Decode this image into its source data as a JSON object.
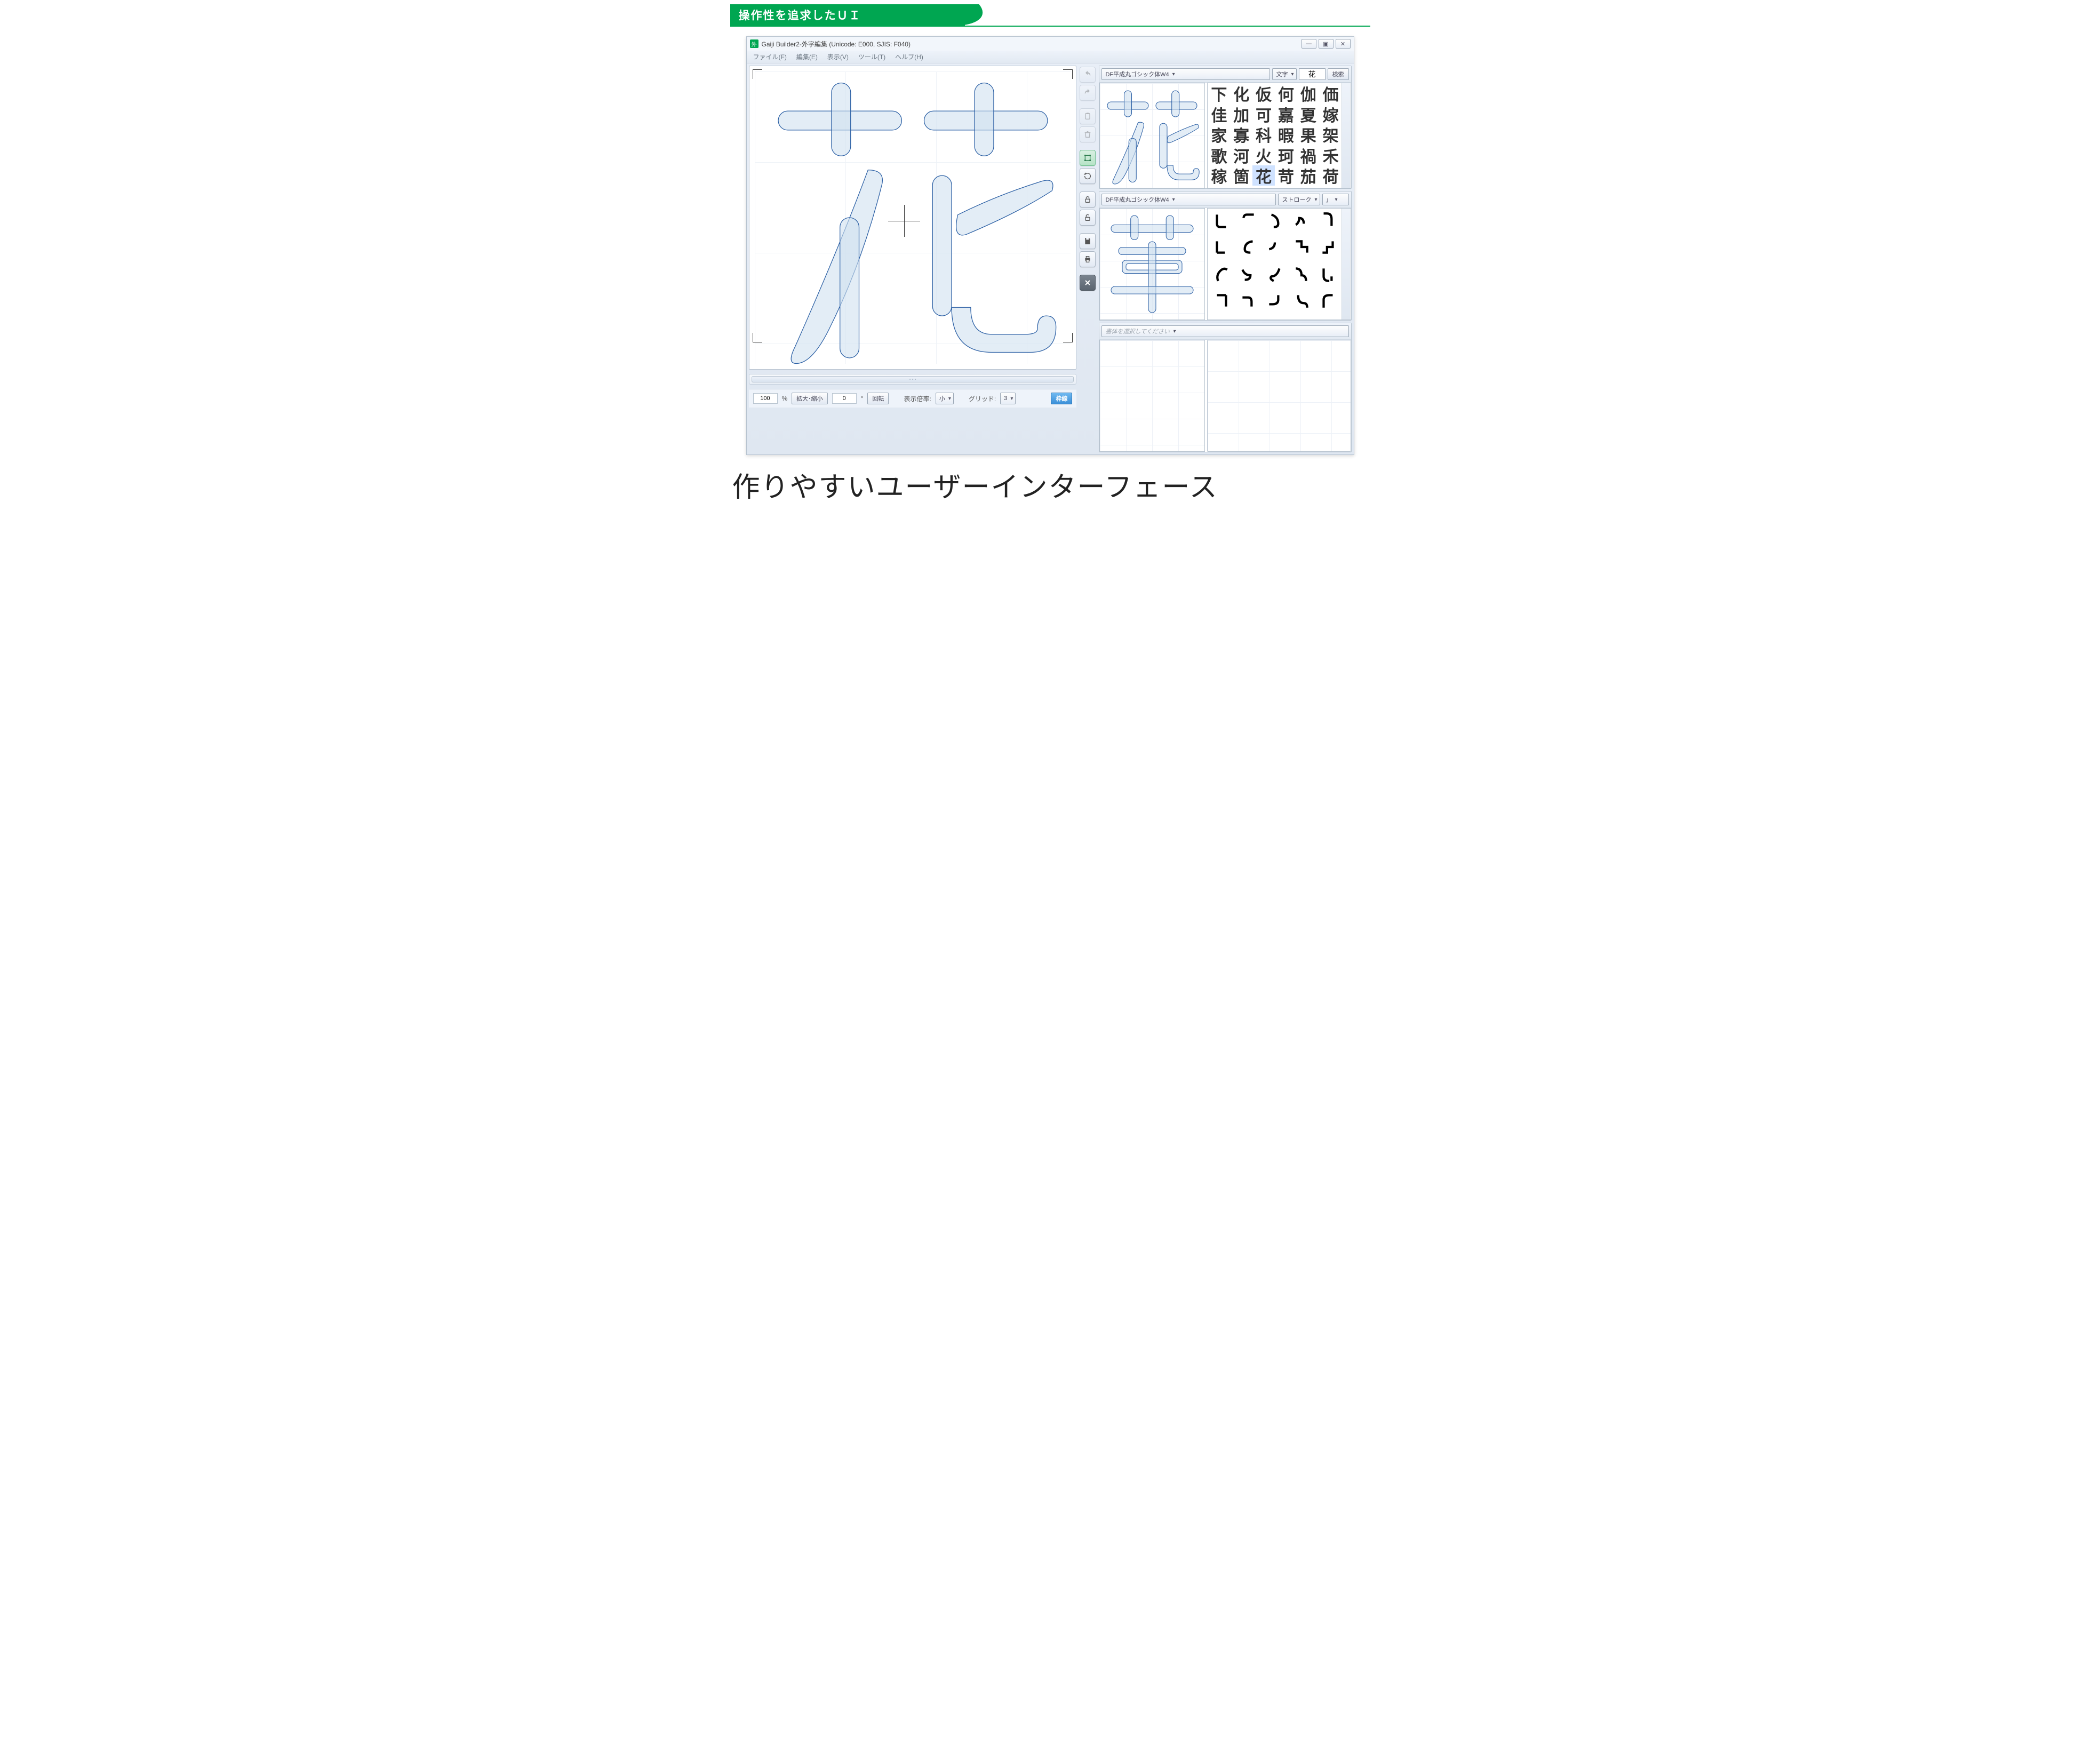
{
  "banner": {
    "title": "操作性を追求したＵＩ"
  },
  "titlebar": {
    "icon_label": "外",
    "title": "Gaiji Builder2-外字編集 (Unicode: E000, SJIS: F040)"
  },
  "window_controls": {
    "minimize": "—",
    "maximize": "▣",
    "close": "✕"
  },
  "menubar": {
    "file": "ファイル(F)",
    "edit": "編集(E)",
    "view": "表示(V)",
    "tools": "ツール(T)",
    "help": "ヘルプ(H)"
  },
  "tools": {
    "undo": "undo-icon",
    "redo": "redo-icon",
    "paste": "paste-icon",
    "delete": "delete-icon",
    "bounds": "bounds-icon",
    "rotate": "rotate-icon",
    "lock": "lock-icon",
    "unlock": "unlock-icon",
    "save": "save-icon",
    "print": "print-icon",
    "close": "close-icon"
  },
  "char_panel": {
    "font": "DF平成丸ゴシック体W4",
    "mode": "文字",
    "search_value": "花",
    "search_button": "検索",
    "chars": [
      "下",
      "化",
      "仮",
      "何",
      "伽",
      "価",
      "佳",
      "加",
      "可",
      "嘉",
      "夏",
      "嫁",
      "家",
      "寡",
      "科",
      "暇",
      "果",
      "架",
      "歌",
      "河",
      "火",
      "珂",
      "禍",
      "禾",
      "稼",
      "箇",
      "花",
      "苛",
      "茄",
      "荷"
    ],
    "selected_index": 26
  },
  "stroke_panel": {
    "font": "DF平成丸ゴシック体W4",
    "mode": "ストローク",
    "filter": "」"
  },
  "bottom_panel": {
    "placeholder": "書体を選択してください"
  },
  "status": {
    "zoom_value": "100",
    "zoom_unit": "%",
    "zoom_label": "拡大･縮小",
    "angle_value": "0",
    "angle_unit": "°",
    "rotate_label": "回転",
    "display_scale_label": "表示倍率:",
    "display_scale_value": "小",
    "grid_label": "グリッド:",
    "grid_value": "3",
    "frame_button": "枠線"
  },
  "caption": "作りやすいユーザーインターフェース"
}
